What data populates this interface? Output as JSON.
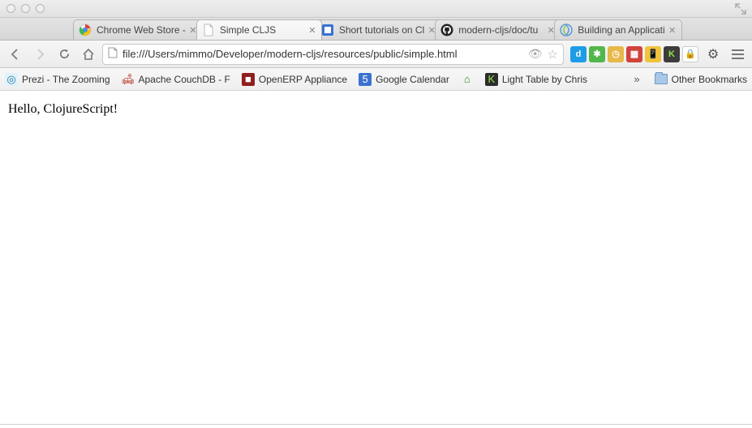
{
  "tabs": [
    {
      "label": "Chrome Web Store - ",
      "favicon": "chrome-icon"
    },
    {
      "label": "Simple CLJS",
      "favicon": "file-icon",
      "active": true
    },
    {
      "label": "Short tutorials on Cl",
      "favicon": "app-icon"
    },
    {
      "label": "modern-cljs/doc/tu",
      "favicon": "github-icon"
    },
    {
      "label": "Building an Applicati",
      "favicon": "cljs-icon"
    }
  ],
  "toolbar": {
    "url": "file:///Users/mimmo/Developer/modern-cljs/resources/public/simple.html"
  },
  "extensions": [
    {
      "name": "diigo",
      "bg": "#1e9de6",
      "char": "d"
    },
    {
      "name": "evernote",
      "bg": "#53b74c",
      "char": "✱"
    },
    {
      "name": "pocket",
      "bg": "#e7b84a",
      "char": "◷"
    },
    {
      "name": "speakerdeck",
      "bg": "#d1433b",
      "char": "▦"
    },
    {
      "name": "buffer",
      "bg": "#f2c23a",
      "char": "📱"
    },
    {
      "name": "xkit",
      "bg": "#3c3c3c",
      "char": "K",
      "fg": "#8fe34a"
    },
    {
      "name": "adblock",
      "bg": "#fff",
      "char": "🔒"
    }
  ],
  "bookmarks": [
    {
      "label": "Prezi - The Zooming",
      "icon": "◎",
      "bg": "#dff3fb",
      "color": "#2a78a8"
    },
    {
      "label": "Apache CouchDB - F",
      "icon": "🛋",
      "bg": "",
      "color": "#b7342a"
    },
    {
      "label": "OpenERP Appliance",
      "icon": "■",
      "bg": "#8f1f1f",
      "color": "#fff"
    },
    {
      "label": "Google Calendar",
      "icon": "5",
      "bg": "#3a72d0",
      "color": "#fff"
    },
    {
      "label": "",
      "icon": "⌂",
      "bg": "",
      "color": "#2e8b2e"
    },
    {
      "label": "Light Table by Chris",
      "icon": "K",
      "bg": "#2c2c2c",
      "color": "#9be24c"
    }
  ],
  "otherBookmarksLabel": "Other Bookmarks",
  "page": {
    "heading": "Hello, ClojureScript!"
  }
}
